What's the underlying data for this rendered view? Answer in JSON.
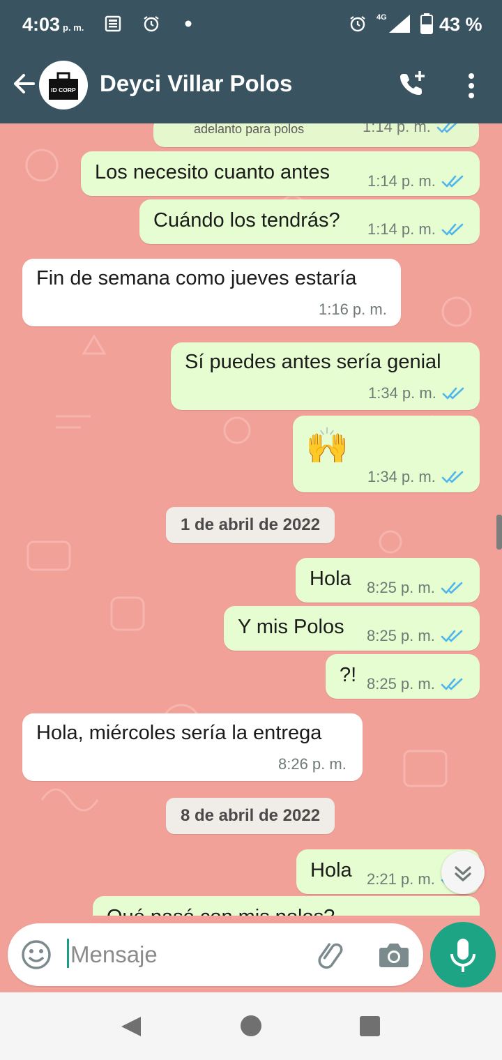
{
  "status_bar": {
    "time": "4:03",
    "time_suffix": "p. m.",
    "network": "4G",
    "battery": "43 %"
  },
  "header": {
    "contact_name": "Deyci Villar Polos",
    "avatar_text": "ID CORP"
  },
  "chat": {
    "messages": [
      {
        "dir": "out",
        "text": "adelanto para polos",
        "time": "1:14 p. m.",
        "read": true
      },
      {
        "dir": "out",
        "text": "Los necesito cuanto antes",
        "time": "1:14 p. m.",
        "read": true
      },
      {
        "dir": "out",
        "text": "Cuándo los tendrás?",
        "time": "1:14 p. m.",
        "read": true
      },
      {
        "dir": "in",
        "text": "Fin de semana como jueves estaría",
        "time": "1:16 p. m."
      },
      {
        "dir": "out",
        "text": "Sí puedes antes sería genial",
        "time": "1:34 p. m.",
        "read": true
      },
      {
        "dir": "out",
        "text": "🙌",
        "time": "1:34 p. m.",
        "read": true
      },
      {
        "dir": "out",
        "text": "Hola",
        "time": "8:25 p. m.",
        "read": true
      },
      {
        "dir": "out",
        "text": "Y mis Polos",
        "time": "8:25 p. m.",
        "read": true
      },
      {
        "dir": "out",
        "text": "?!",
        "time": "8:25 p. m.",
        "read": true
      },
      {
        "dir": "in",
        "text": "Hola, miércoles sería la entrega",
        "time": "8:26 p. m."
      },
      {
        "dir": "out",
        "text": "Hola",
        "time": "2:21 p. m.",
        "read": true
      },
      {
        "dir": "out",
        "text": "Qué pasó con mis polos?"
      }
    ],
    "dates": [
      "1 de abril de 2022",
      "8 de abril de 2022"
    ]
  },
  "input": {
    "placeholder": "Mensaje"
  },
  "colors": {
    "header": "#3a5361",
    "wallpaper": "#f2a198",
    "outgoing_bubble": "#e5fdd0",
    "incoming_bubble": "#ffffff",
    "read_ticks": "#4fb6ec",
    "mic_button": "#1ca485"
  },
  "icons": [
    "back-arrow-icon",
    "add-call-icon",
    "more-options-icon",
    "emoji-icon",
    "attach-icon",
    "camera-icon",
    "mic-icon",
    "scroll-down-icon"
  ]
}
